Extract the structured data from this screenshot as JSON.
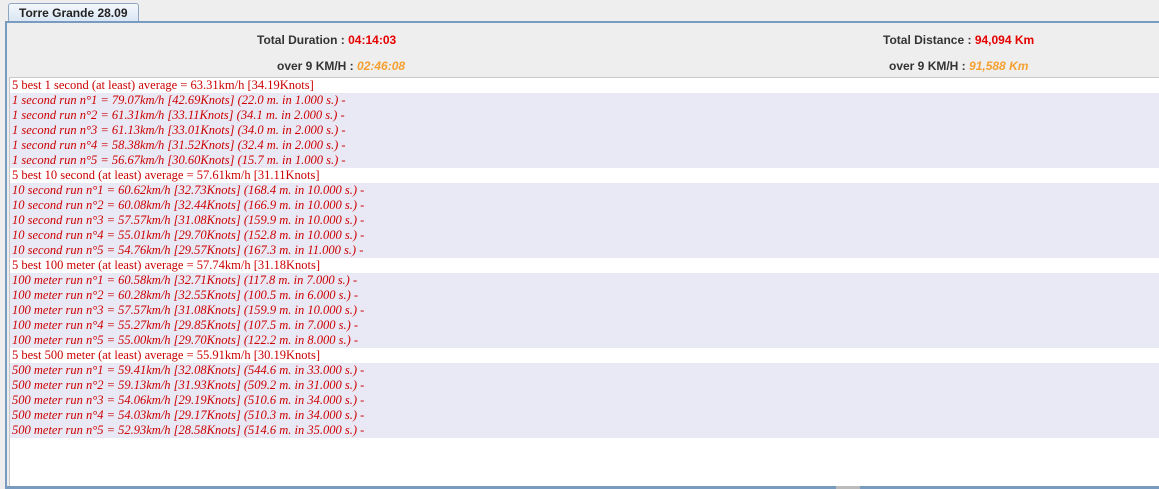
{
  "tab": {
    "label": "Torre Grande 28.09"
  },
  "summary": {
    "duration_label": "Total Duration :",
    "duration_value": "04:14:03",
    "distance_label": "Total Distance :",
    "distance_value": "94,094 Km",
    "over9_label": "over  9 KM/H :",
    "over9_time": "02:46:08",
    "over9_label2": "over  9 KM/H :",
    "over9_distance": "91,588 Km"
  },
  "colors": {
    "accent_red": "#e60000",
    "accent_orange": "#f5a030",
    "row_bg": "#e9e9f6"
  },
  "rows": [
    {
      "t": "header",
      "text": "5 best 1 second (at least) average = 63.31km/h [34.19Knots]"
    },
    {
      "t": "run",
      "text": "1 second run n°1 = 79.07km/h [42.69Knots] (22.0 m. in 1.000 s.) -"
    },
    {
      "t": "run",
      "text": "1 second run n°2 = 61.31km/h [33.11Knots] (34.1 m. in 2.000 s.) -"
    },
    {
      "t": "run",
      "text": "1 second run n°3 = 61.13km/h [33.01Knots] (34.0 m. in 2.000 s.) -"
    },
    {
      "t": "run",
      "text": "1 second run n°4 = 58.38km/h [31.52Knots] (32.4 m. in 2.000 s.) -"
    },
    {
      "t": "run",
      "text": "1 second run n°5 = 56.67km/h [30.60Knots] (15.7 m. in 1.000 s.) -"
    },
    {
      "t": "header",
      "text": "5 best 10 second (at least) average = 57.61km/h [31.11Knots]"
    },
    {
      "t": "run",
      "text": "10 second run n°1 = 60.62km/h [32.73Knots] (168.4 m. in 10.000 s.) -"
    },
    {
      "t": "run",
      "text": "10 second run n°2 = 60.08km/h [32.44Knots] (166.9 m. in 10.000 s.) -"
    },
    {
      "t": "run",
      "text": "10 second run n°3 = 57.57km/h [31.08Knots] (159.9 m. in 10.000 s.) -"
    },
    {
      "t": "run",
      "text": "10 second run n°4 = 55.01km/h [29.70Knots] (152.8 m. in 10.000 s.) -"
    },
    {
      "t": "run",
      "text": "10 second run n°5 = 54.76km/h [29.57Knots] (167.3 m. in 11.000 s.) -"
    },
    {
      "t": "header",
      "text": "5 best 100 meter (at least) average = 57.74km/h [31.18Knots]"
    },
    {
      "t": "run",
      "text": "100 meter run n°1 = 60.58km/h [32.71Knots] (117.8 m. in 7.000 s.) -"
    },
    {
      "t": "run",
      "text": "100 meter run n°2 = 60.28km/h [32.55Knots] (100.5 m. in 6.000 s.) -"
    },
    {
      "t": "run",
      "text": "100 meter run n°3 = 57.57km/h [31.08Knots] (159.9 m. in 10.000 s.) -"
    },
    {
      "t": "run",
      "text": "100 meter run n°4 = 55.27km/h [29.85Knots] (107.5 m. in 7.000 s.) -"
    },
    {
      "t": "run",
      "text": "100 meter run n°5 = 55.00km/h [29.70Knots] (122.2 m. in 8.000 s.) -"
    },
    {
      "t": "header",
      "text": "5 best 500 meter (at least) average = 55.91km/h [30.19Knots]"
    },
    {
      "t": "run",
      "text": "500 meter run n°1 = 59.41km/h [32.08Knots] (544.6 m. in 33.000 s.) -"
    },
    {
      "t": "run",
      "text": "500 meter run n°2 = 59.13km/h [31.93Knots] (509.2 m. in 31.000 s.) -"
    },
    {
      "t": "run",
      "text": "500 meter run n°3 = 54.06km/h [29.19Knots] (510.6 m. in 34.000 s.) -"
    },
    {
      "t": "run",
      "text": "500 meter run n°4 = 54.03km/h [29.17Knots] (510.3 m. in 34.000 s.) -"
    },
    {
      "t": "run",
      "text": "500 meter run n°5 = 52.93km/h [28.58Knots] (514.6 m. in 35.000 s.) -"
    }
  ]
}
